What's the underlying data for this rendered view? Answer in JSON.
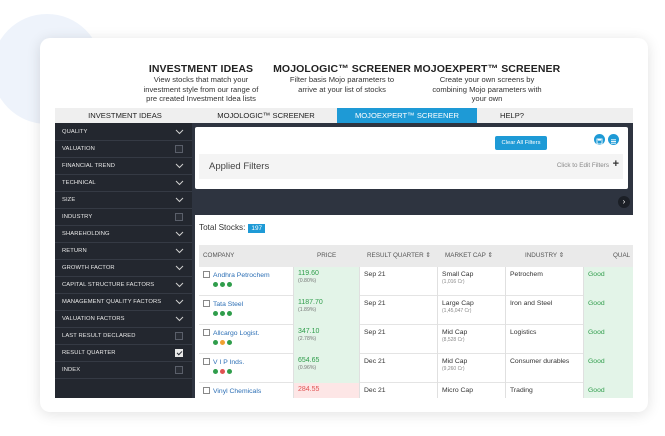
{
  "hero": [
    {
      "title": "INVESTMENT IDEAS",
      "desc": [
        "View stocks that match your",
        "investment style from our range of",
        "pre created Investment Idea lists"
      ]
    },
    {
      "title": "MOJOLOGIC™ SCREENER",
      "desc": [
        "Filter basis Mojo parameters to",
        "arrive at your list of stocks"
      ]
    },
    {
      "title": "MOJOEXPERT™ SCREENER",
      "desc": [
        "Create your own screens by",
        "combining Mojo parameters with",
        "your own"
      ]
    }
  ],
  "tabs": [
    {
      "label": "INVESTMENT IDEAS",
      "active": false
    },
    {
      "label": "MOJOLOGIC™ SCREENER",
      "active": false
    },
    {
      "label": "MOJOEXPERT™ SCREENER",
      "active": true
    },
    {
      "label": "HELP?",
      "active": false
    }
  ],
  "sidebar": [
    {
      "label": "QUALITY",
      "control": "chevron"
    },
    {
      "label": "VALUATION",
      "control": "checkbox",
      "checked": false
    },
    {
      "label": "FINANCIAL TREND",
      "control": "chevron"
    },
    {
      "label": "TECHNICAL",
      "control": "chevron"
    },
    {
      "label": "SIZE",
      "control": "chevron"
    },
    {
      "label": "INDUSTRY",
      "control": "checkbox",
      "checked": false
    },
    {
      "label": "SHAREHOLDING",
      "control": "chevron"
    },
    {
      "label": "RETURN",
      "control": "chevron"
    },
    {
      "label": "GROWTH FACTOR",
      "control": "chevron"
    },
    {
      "label": "CAPITAL STRUCTURE FACTORS",
      "control": "chevron"
    },
    {
      "label": "MANAGEMENT QUALITY FACTORS",
      "control": "chevron"
    },
    {
      "label": "VALUATION FACTORS",
      "control": "chevron"
    },
    {
      "label": "LAST RESULT DECLARED",
      "control": "checkbox",
      "checked": false
    },
    {
      "label": "RESULT QUARTER",
      "control": "checkbox",
      "checked": true
    },
    {
      "label": "INDEX",
      "control": "checkbox",
      "checked": false
    }
  ],
  "filters": {
    "clear_label": "Clear All Filters",
    "applied_label": "Applied Filters",
    "edit_label": "Click to Edit Filters",
    "plus": "+"
  },
  "table": {
    "total_label": "Total Stocks:",
    "total_count": "197",
    "headers": [
      "COMPANY",
      "PRICE",
      "RESULT QUARTER ⇕",
      "MARKET CAP ⇕",
      "INDUSTRY ⇕",
      "QUAL"
    ],
    "rows": [
      {
        "name": "Andhra Petrochem",
        "price": "119.60",
        "change": "(0.80%)",
        "price_color": "green",
        "quarter": "Sep 21",
        "mcap": "Small Cap",
        "mcap_sub": "(1,016 Cr)",
        "industry": "Petrochem",
        "quality": "Good",
        "dots": [
          "#2f9d4b",
          "#2f9d4b",
          "#2f9d4b"
        ]
      },
      {
        "name": "Tata Steel",
        "price": "1187.70",
        "change": "(1.89%)",
        "price_color": "green",
        "quarter": "Sep 21",
        "mcap": "Large Cap",
        "mcap_sub": "(1,45,047 Cr)",
        "industry": "Iron and Steel",
        "quality": "Good",
        "dots": [
          "#2f9d4b",
          "#2f9d4b",
          "#2f9d4b"
        ]
      },
      {
        "name": "Allcargo Logist.",
        "price": "347.10",
        "change": "(2.78%)",
        "price_color": "green",
        "quarter": "Sep 21",
        "mcap": "Mid Cap",
        "mcap_sub": "(8,528 Cr)",
        "industry": "Logistics",
        "quality": "Good",
        "dots": [
          "#2f9d4b",
          "#f0a030",
          "#2f9d4b"
        ]
      },
      {
        "name": "V I P Inds.",
        "price": "654.65",
        "change": "(0.96%)",
        "price_color": "green",
        "quarter": "Dec 21",
        "mcap": "Mid Cap",
        "mcap_sub": "(9,260 Cr)",
        "industry": "Consumer durables",
        "quality": "Good",
        "dots": [
          "#2f9d4b",
          "#e05252",
          "#2f9d4b"
        ]
      },
      {
        "name": "Vinyl Chemicals",
        "price": "284.55",
        "change": "",
        "price_color": "red",
        "quarter": "Dec 21",
        "mcap": "Micro Cap",
        "mcap_sub": "",
        "industry": "Trading",
        "quality": "Good",
        "dots": []
      }
    ]
  },
  "icons": {
    "save": "save-icon",
    "menu": "menu-icon",
    "chevron": "chevron-down-icon",
    "scroll": "chevron-right-icon"
  }
}
